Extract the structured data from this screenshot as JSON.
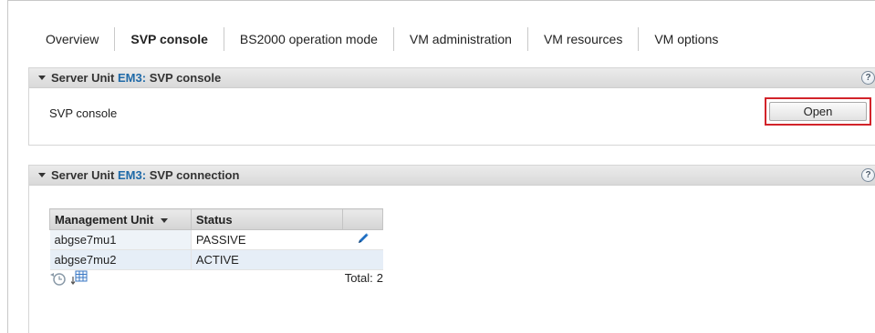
{
  "tabs": [
    {
      "label": "Overview",
      "active": false
    },
    {
      "label": "SVP console",
      "active": true
    },
    {
      "label": "BS2000 operation mode",
      "active": false
    },
    {
      "label": "VM administration",
      "active": false
    },
    {
      "label": "VM resources",
      "active": false
    },
    {
      "label": "VM options",
      "active": false
    }
  ],
  "panel_console": {
    "title_prefix": "Server Unit",
    "unit": "EM3:",
    "title_suffix": "SVP console",
    "help": "?",
    "label": "SVP console",
    "button": "Open"
  },
  "panel_connection": {
    "title_prefix": "Server Unit",
    "unit": "EM3:",
    "title_suffix": "SVP connection",
    "help": "?",
    "columns": [
      "Management Unit",
      "Status",
      ""
    ],
    "rows": [
      {
        "unit": "abgse7mu1",
        "status": "PASSIVE",
        "action_icon": "edit-pencil-icon"
      },
      {
        "unit": "abgse7mu2",
        "status": "ACTIVE",
        "action_icon": ""
      }
    ],
    "footer_icons": [
      "history-icon",
      "export-table-icon"
    ],
    "total_label": "Total:",
    "total_value": "2"
  },
  "colors": {
    "accent_link": "#1f6aa8",
    "highlight_box": "#d2232a",
    "row_alt": "#e6eef7",
    "edit_icon": "#1f6ec2"
  }
}
